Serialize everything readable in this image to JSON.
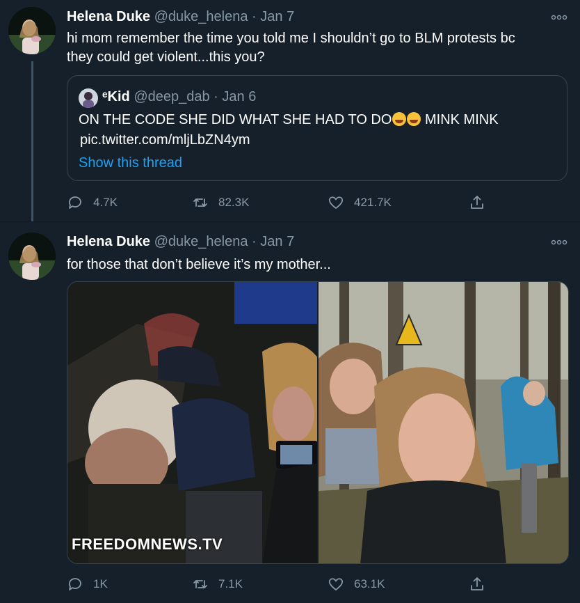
{
  "tweets": [
    {
      "name": "Helena Duke",
      "handle": "@duke_helena",
      "separator": "·",
      "date": "Jan 7",
      "text_line1": "hi mom remember the time you told me I shouldn’t go to BLM protests bc",
      "text_line2": "they could get violent...this you?",
      "quote": {
        "name": "ᵉKid",
        "handle": "@deep_dab",
        "separator": "·",
        "date": "Jan 6",
        "text": "ON THE CODE SHE DID WHAT SHE HAD TO DO",
        "text_after_emoji": " MINK MINK",
        "link": "pic.twitter.com/mljLbZN4ym",
        "show_thread": "Show this thread"
      },
      "actions": {
        "replies": "4.7K",
        "retweets": "82.3K",
        "likes": "421.7K"
      }
    },
    {
      "name": "Helena Duke",
      "handle": "@duke_helena",
      "separator": "·",
      "date": "Jan 7",
      "text": "for those that don’t believe it’s my mother...",
      "media": {
        "watermark": "FREEDOMNEWS.TV"
      },
      "actions": {
        "replies": "1K",
        "retweets": "7.1K",
        "likes": "63.1K"
      }
    }
  ],
  "icons": {
    "reply": "speech-bubble-icon",
    "retweet": "retweet-arrows-icon",
    "like": "heart-outline-icon",
    "share": "share-upload-icon",
    "more": "more-options-dots-icon",
    "emoji": "rolling-on-floor-laughing-emoji"
  },
  "colors": {
    "background": "#15202b",
    "secondary_text": "#8899a6",
    "link": "#1da1f2",
    "border": "#38444d",
    "thread_line": "#3d5466"
  }
}
